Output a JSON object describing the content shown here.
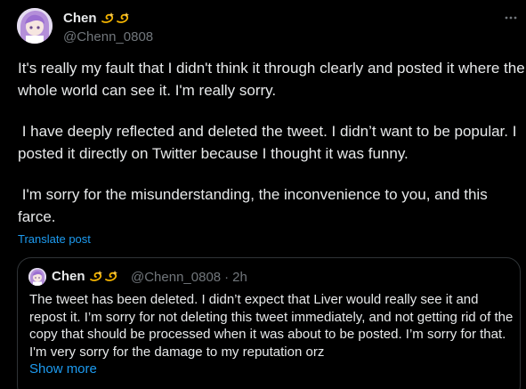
{
  "author": {
    "display_name": "Chen",
    "handle": "@Chenn_0808",
    "badge_emoji": [
      "dizzy-emoji",
      "dizzy-emoji"
    ]
  },
  "tweet": {
    "paragraphs": [
      "It's really my fault that I didn't think it through clearly and posted it where the whole world can see it. I'm really sorry.",
      " I have deeply reflected and deleted the tweet. I didn’t want to be popular. I posted it directly on Twitter because I thought it was funny.",
      " I'm sorry for the misunderstanding, the inconvenience to you, and this farce."
    ],
    "translate_label": "Translate post"
  },
  "quoted_tweet": {
    "display_name": "Chen",
    "handle": "@Chenn_0808",
    "separator": "·",
    "time": "2h",
    "text": "The tweet has been deleted. I didn’t expect that Liver would really see it and repost it. I’m sorry for not deleting this tweet immediately, and not getting rid of the copy that should be processed when it was about to be posted. I’m sorry for that. I'm very sorry for the damage to my reputation orz",
    "show_more_label": "Show more"
  },
  "icons": {
    "more": "more-horizontal-icon",
    "emoji": "dizzy-emoji"
  },
  "colors": {
    "background": "#000000",
    "text": "#e7e9ea",
    "secondary_text": "#71767b",
    "link": "#1d9bf0",
    "border": "#2f3336"
  }
}
